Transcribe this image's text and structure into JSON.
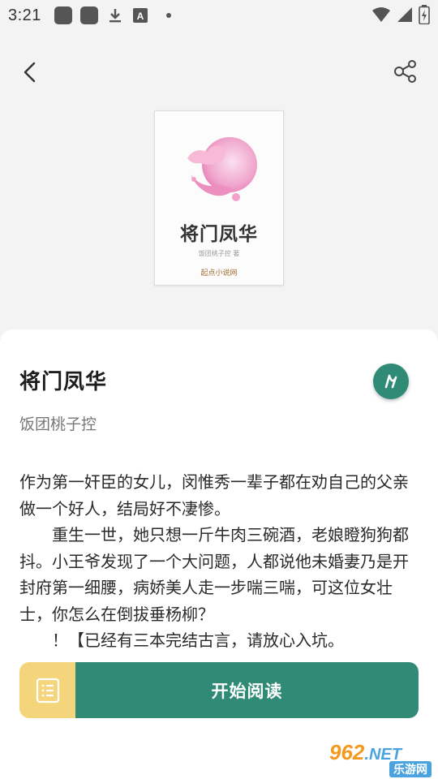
{
  "status_bar": {
    "time": "3:21",
    "a_icon_letter": "A"
  },
  "nav": {
    "back_icon": "chevron-left-icon",
    "share_icon": "share-icon"
  },
  "cover": {
    "title": "将门凤华",
    "author": "饭团桃子控 著",
    "publisher_logo": "起点小说网"
  },
  "book": {
    "title": "将门凤华",
    "author": "饭团桃子控",
    "synopsis": [
      "作为第一奸臣的女儿，闵惟秀一辈子都在劝自己的父亲做一个好人，结局好不凄惨。",
      "　　重生一世，她只想一斤牛肉三碗酒，老娘瞪狗狗都抖。小王爷发现了一个大问题，人都说他未婚妻乃是开封府第一细腰，病娇美人走一步喘三喘，可这位女壮士，你怎么在倒拔垂杨柳？",
      "　　！【已经有三本完结古言，请放心入坑。"
    ]
  },
  "actions": {
    "catalog_icon": "catalog-list-icon",
    "start_reading_label": "开始阅读"
  },
  "watermark": {
    "brand": "962",
    "domain_suffix": ".NET",
    "tagline": "乐游网"
  },
  "colors": {
    "accent_green": "#2f8a76",
    "catalog_yellow": "#f4d57c",
    "page_bg": "#f3f3f3"
  }
}
